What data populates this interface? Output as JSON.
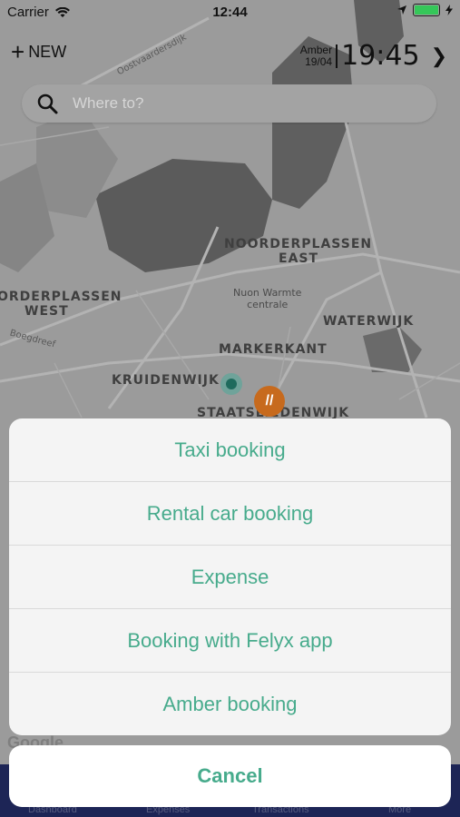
{
  "status_bar": {
    "carrier": "Carrier",
    "time": "12:44"
  },
  "header": {
    "new_label": "NEW",
    "clock_name": "Amber",
    "clock_date": "19/04",
    "clock_time": "19:45"
  },
  "search": {
    "placeholder": "Where to?"
  },
  "map": {
    "labels": {
      "noorderplassen_east_1": "NOORDERPLASSEN",
      "noorderplassen_east_2": "EAST",
      "noorderplassen_west_1": "ORDERPLASSEN",
      "noorderplassen_west_2": "WEST",
      "nuon_1": "Nuon Warmte",
      "nuon_2": "centrale",
      "waterwijk": "WATERWIJK",
      "markerkant": "MARKERKANT",
      "kruidenwijk": "KRUIDENWIJK",
      "staatsliedenwijk": "STAATSLIEDENWIJK",
      "oostvaardersdijk": "Oostvaardersdijk",
      "boegdreef": "Boegdreef"
    },
    "felyx_marker": "//",
    "google_logo": "Google"
  },
  "tabbar": {
    "tabs": [
      "Dashboard",
      "Expenses",
      "Transactions",
      "More"
    ]
  },
  "action_sheet": {
    "options": [
      "Taxi booking",
      "Rental car booking",
      "Expense",
      "Booking with Felyx app",
      "Amber booking"
    ],
    "cancel": "Cancel"
  },
  "colors": {
    "accent": "#47ab8c",
    "tabbar": "#1d2556",
    "felyx": "#c76a1d"
  }
}
